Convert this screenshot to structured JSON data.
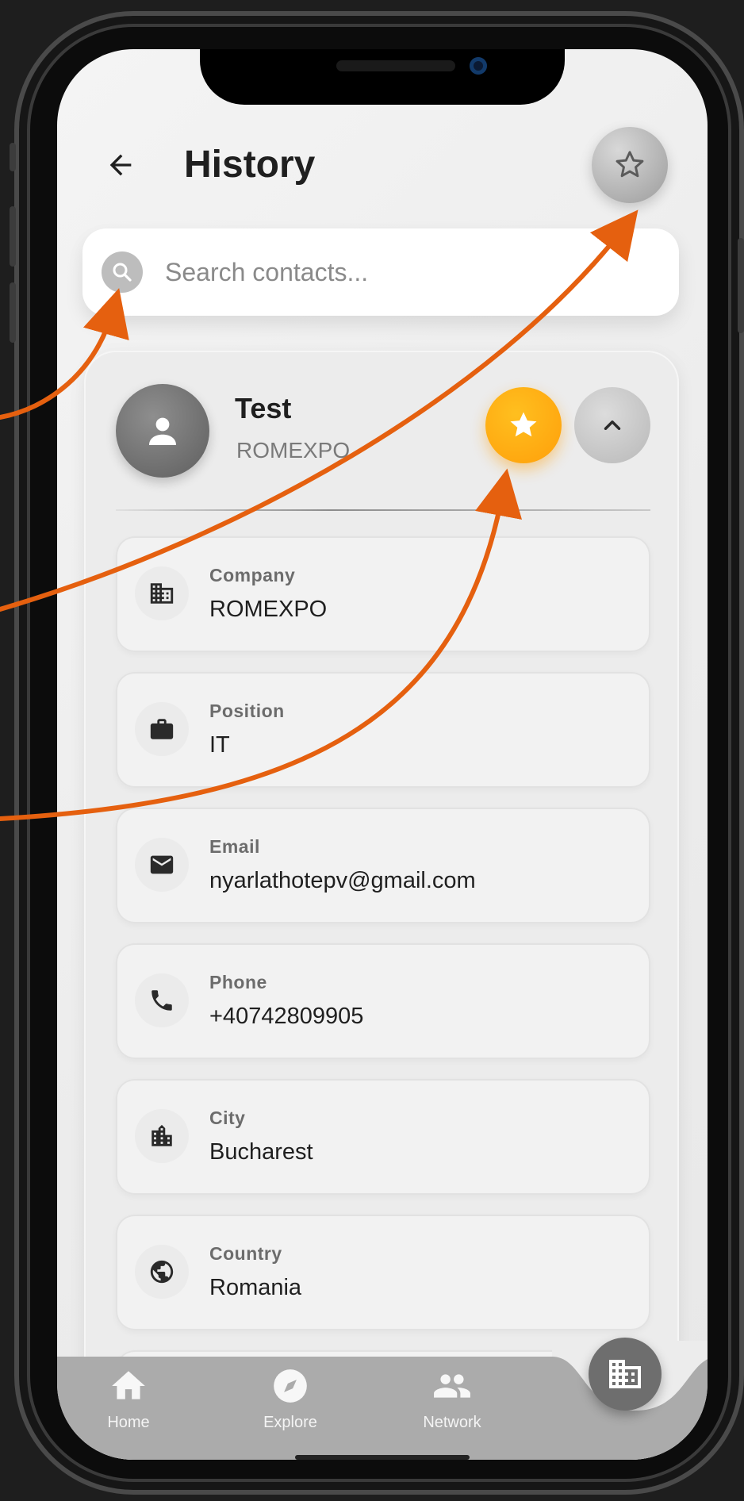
{
  "header": {
    "title": "History",
    "back_icon": "arrow-left-icon",
    "favorites_filter_icon": "star-outline-icon"
  },
  "search": {
    "placeholder": "Search contacts...",
    "value": "",
    "icon": "search-icon"
  },
  "contact": {
    "name": "Test",
    "company": "ROMEXPO",
    "favorite": true,
    "expanded": true,
    "fields": [
      {
        "label": "Company",
        "value": "ROMEXPO",
        "icon": "building-icon"
      },
      {
        "label": "Position",
        "value": "IT",
        "icon": "briefcase-icon"
      },
      {
        "label": "Email",
        "value": "nyarlathotepv@gmail.com",
        "icon": "mail-icon"
      },
      {
        "label": "Phone",
        "value": "+40742809905",
        "icon": "phone-icon"
      },
      {
        "label": "City",
        "value": "Bucharest",
        "icon": "city-icon"
      },
      {
        "label": "Country",
        "value": "Romania",
        "icon": "globe-icon"
      }
    ]
  },
  "bottom_nav": {
    "items": [
      {
        "label": "Home",
        "icon": "home-icon"
      },
      {
        "label": "Explore",
        "icon": "compass-icon"
      },
      {
        "label": "Network",
        "icon": "people-icon"
      }
    ],
    "fab_icon": "building-icon"
  },
  "colors": {
    "favorite_accent": "#FFA812",
    "annotation_arrow": "#E5600F",
    "nav_background": "#ABABAB"
  }
}
